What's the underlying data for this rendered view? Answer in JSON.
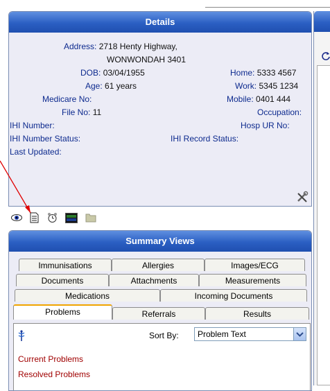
{
  "details": {
    "title": "Details",
    "address_label": "Address:",
    "address_line1": "2718 Henty Highway,",
    "address_line2": "WONWONDAH  3401",
    "dob_label": "DOB:",
    "dob": "03/04/1955",
    "age_label": "Age:",
    "age": "61 years",
    "medicare_label": "Medicare No:",
    "file_label": "File No:",
    "file_no": "11",
    "ihi_label": "IHI Number:",
    "ihi_status_label": "IHI Number Status:",
    "last_updated_label": "Last Updated:",
    "home_label": "Home:",
    "home": "5333 4567",
    "work_label": "Work:",
    "work": "5345 1234",
    "mobile_label": "Mobile:",
    "mobile": "0401 444",
    "occupation_label": "Occupation:",
    "hosp_label": "Hosp UR No:",
    "ihi_record_label": "IHI Record Status:"
  },
  "toolbar_icons": [
    "eye-icon",
    "document-icon",
    "alarm-clock-icon",
    "monitor-icon",
    "folder-icon"
  ],
  "summary": {
    "title": "Summary Views",
    "tabs_row1": [
      "Immunisations",
      "Allergies",
      "Images/ECG"
    ],
    "tabs_row2": [
      "Documents",
      "Attachments",
      "Measurements"
    ],
    "tabs_row3": [
      "Medications",
      "Incoming Documents"
    ],
    "tabs_row4": [
      "Problems",
      "Referrals",
      "Results"
    ],
    "sort_label": "Sort By:",
    "sort_value": "Problem Text",
    "current_problems": "Current Problems",
    "resolved_problems": "Resolved Problems"
  },
  "colors": {
    "header_gradient_top": "#5f8fe0",
    "header_gradient_bottom": "#1f4fb0",
    "panel_bg": "#ececf6",
    "label_blue": "#0d2a8e",
    "problem_red": "#a00000",
    "active_tab_accent": "#f0a400",
    "arrow_red": "#e00000"
  }
}
